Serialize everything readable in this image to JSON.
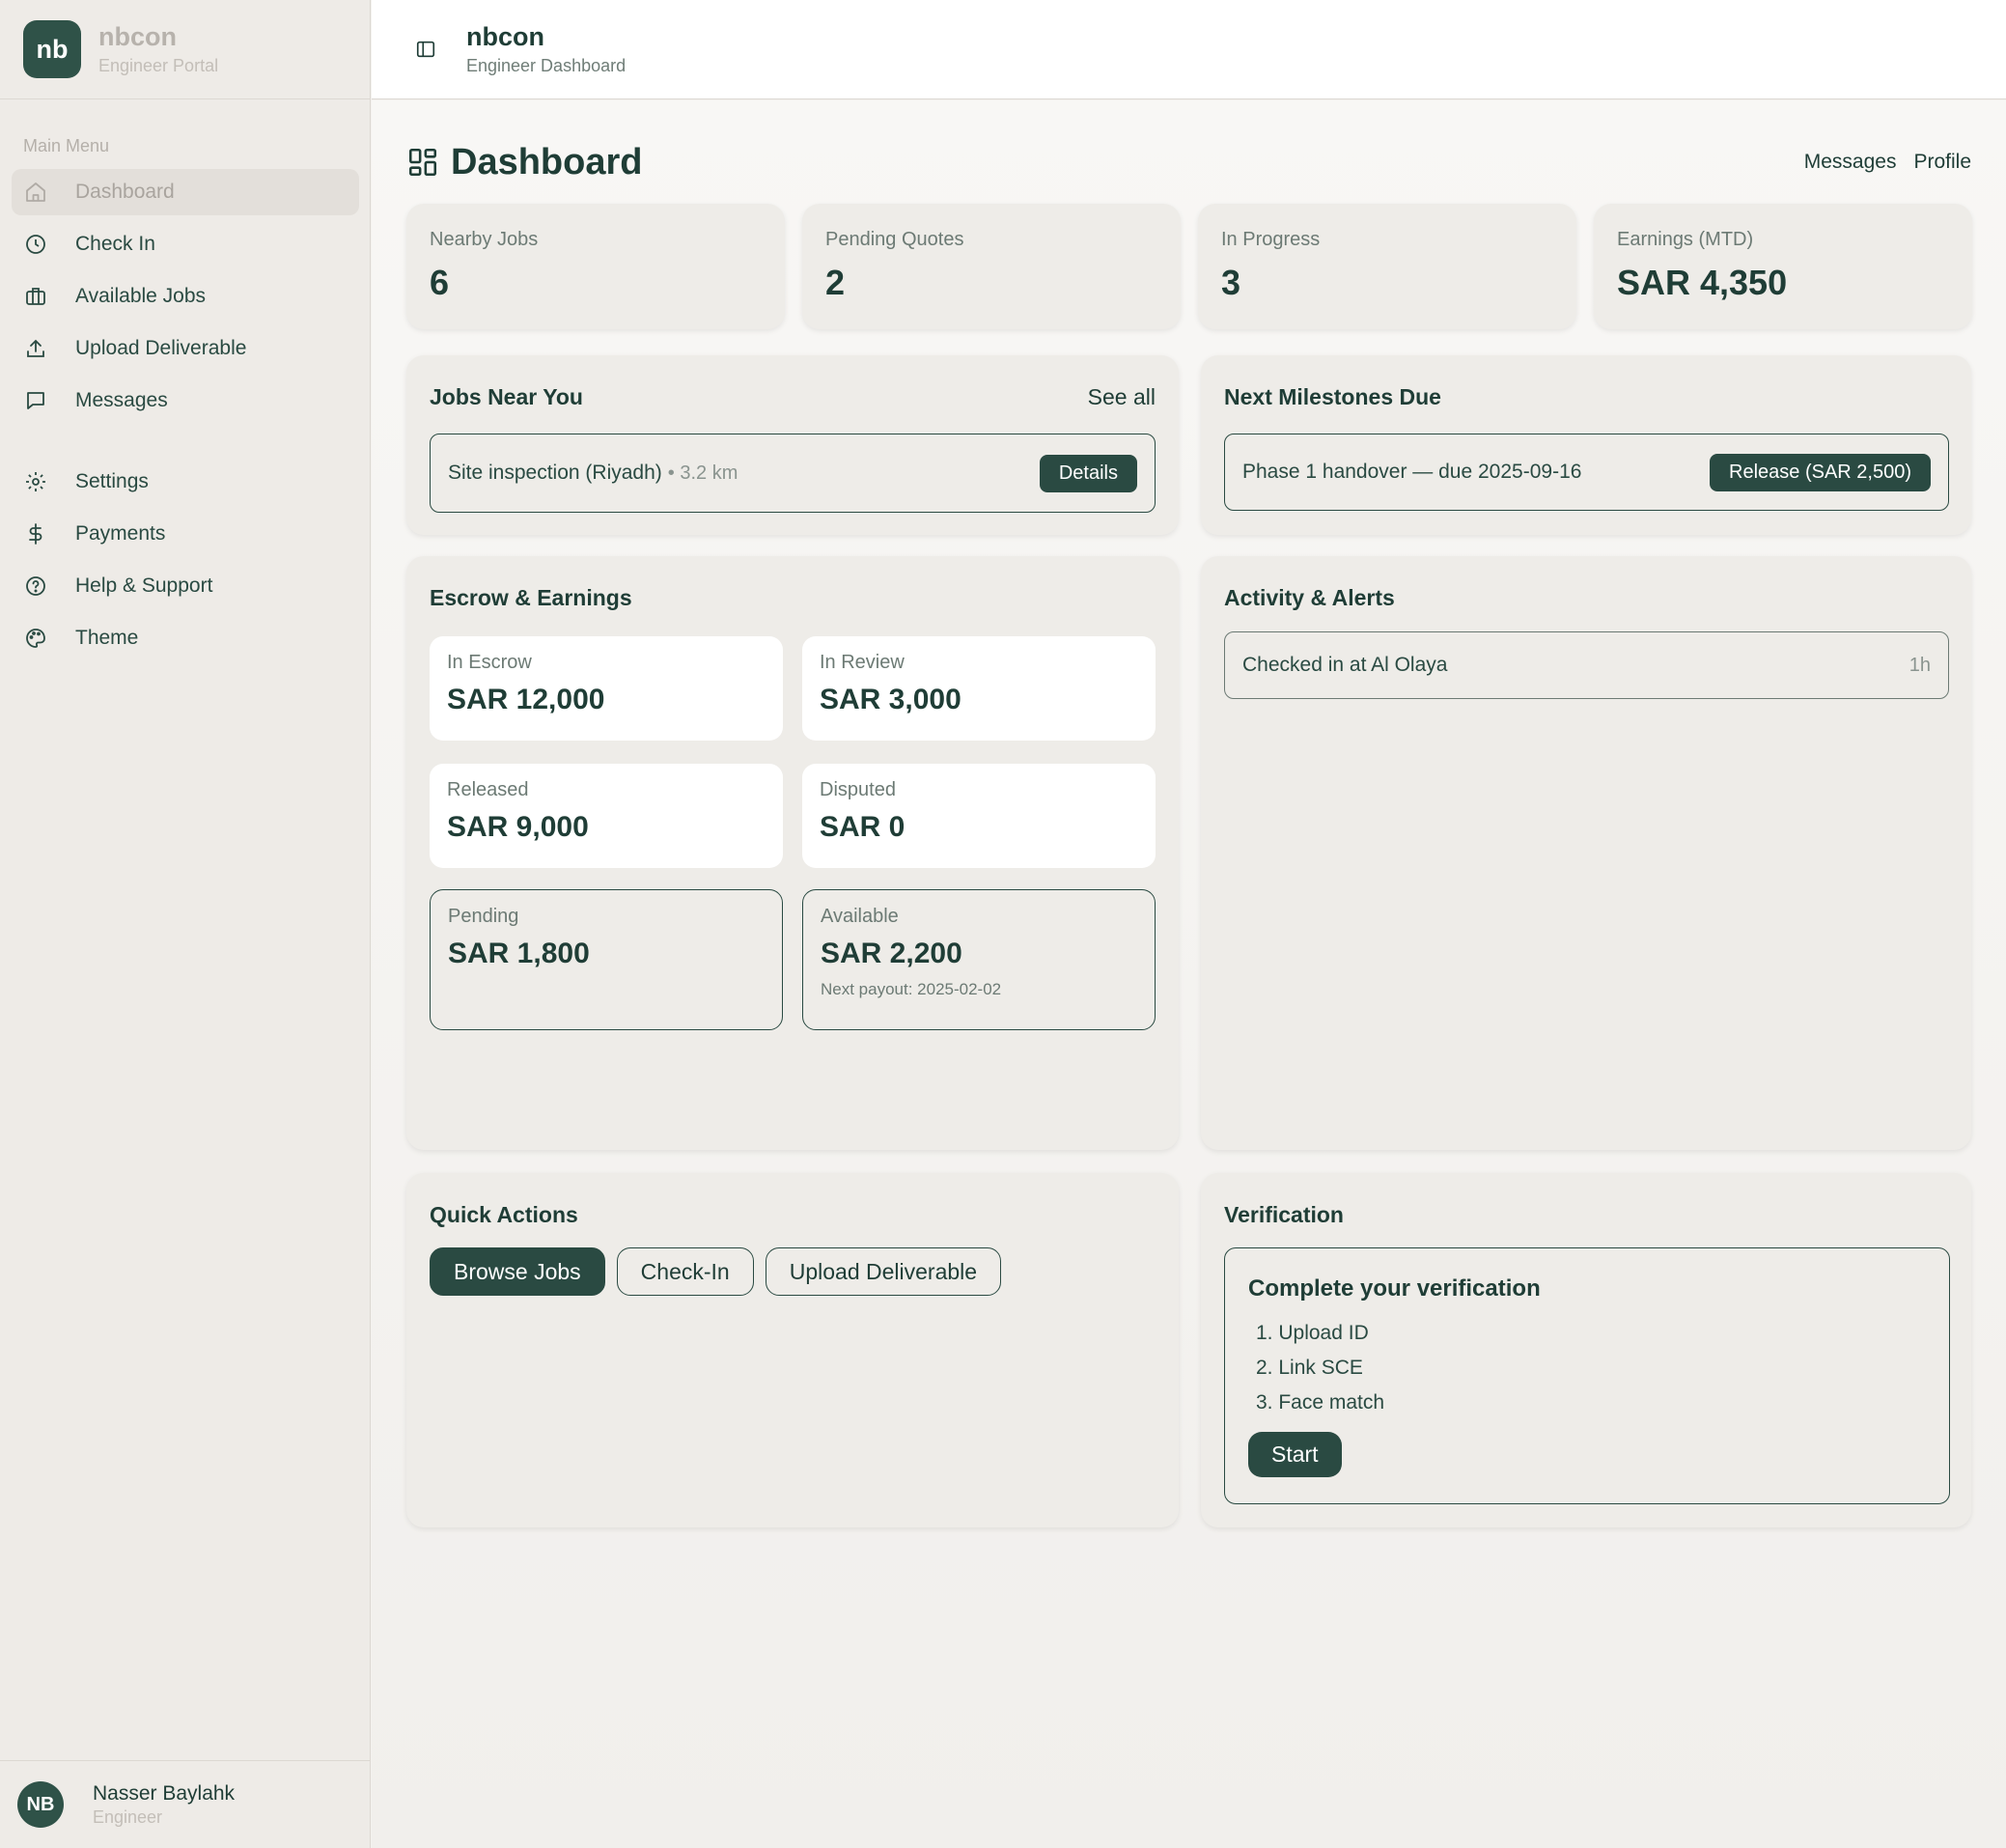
{
  "brand": {
    "logo": "nb",
    "name": "nbcon",
    "subtitle": "Engineer Portal"
  },
  "sidebar": {
    "heading": "Main Menu",
    "items": [
      {
        "label": "Dashboard",
        "icon": "home-icon"
      },
      {
        "label": "Check In",
        "icon": "clock-icon"
      },
      {
        "label": "Available Jobs",
        "icon": "briefcase-icon"
      },
      {
        "label": "Upload Deliverable",
        "icon": "upload-icon"
      },
      {
        "label": "Messages",
        "icon": "message-icon"
      },
      {
        "label": "Settings",
        "icon": "gear-icon"
      },
      {
        "label": "Payments",
        "icon": "dollar-icon"
      },
      {
        "label": "Help & Support",
        "icon": "help-icon"
      },
      {
        "label": "Theme",
        "icon": "palette-icon"
      }
    ]
  },
  "user": {
    "initials": "NB",
    "name": "Nasser Baylahk",
    "role": "Engineer"
  },
  "topbar": {
    "title": "nbcon",
    "subtitle": "Engineer Dashboard"
  },
  "page": {
    "title": "Dashboard",
    "links": {
      "messages": "Messages",
      "profile": "Profile"
    }
  },
  "stats": [
    {
      "label": "Nearby Jobs",
      "value": "6"
    },
    {
      "label": "Pending Quotes",
      "value": "2"
    },
    {
      "label": "In Progress",
      "value": "3"
    },
    {
      "label": "Earnings (MTD)",
      "value": "SAR 4,350"
    }
  ],
  "jobs_near": {
    "title": "Jobs Near You",
    "see_all": "See all",
    "job": {
      "name": "Site inspection (Riyadh)",
      "distance": "• 3.2 km",
      "button": "Details"
    }
  },
  "milestones": {
    "title": "Next Milestones Due",
    "item": {
      "text": "Phase 1 handover — due 2025-09-16",
      "button": "Release (SAR 2,500)"
    }
  },
  "escrow": {
    "title": "Escrow & Earnings",
    "in_escrow": {
      "label": "In Escrow",
      "value": "SAR 12,000"
    },
    "in_review": {
      "label": "In Review",
      "value": "SAR 3,000"
    },
    "released": {
      "label": "Released",
      "value": "SAR 9,000"
    },
    "disputed": {
      "label": "Disputed",
      "value": "SAR 0"
    },
    "pending": {
      "label": "Pending",
      "value": "SAR 1,800"
    },
    "available": {
      "label": "Available",
      "value": "SAR 2,200",
      "note": "Next payout: 2025-02-02"
    }
  },
  "activity": {
    "title": "Activity & Alerts",
    "item": {
      "text": "Checked in at Al Olaya",
      "time": "1h"
    }
  },
  "quick_actions": {
    "title": "Quick Actions",
    "browse": "Browse Jobs",
    "checkin": "Check-In",
    "upload": "Upload Deliverable"
  },
  "verification": {
    "title": "Verification",
    "box_title": "Complete your verification",
    "steps": [
      "1. Upload ID",
      "2. Link SCE",
      "3. Face match"
    ],
    "button": "Start"
  },
  "colors": {
    "primary": "#2a4a42",
    "sidebar_bg": "#eeebe7",
    "card_bg": "#eeece8"
  }
}
